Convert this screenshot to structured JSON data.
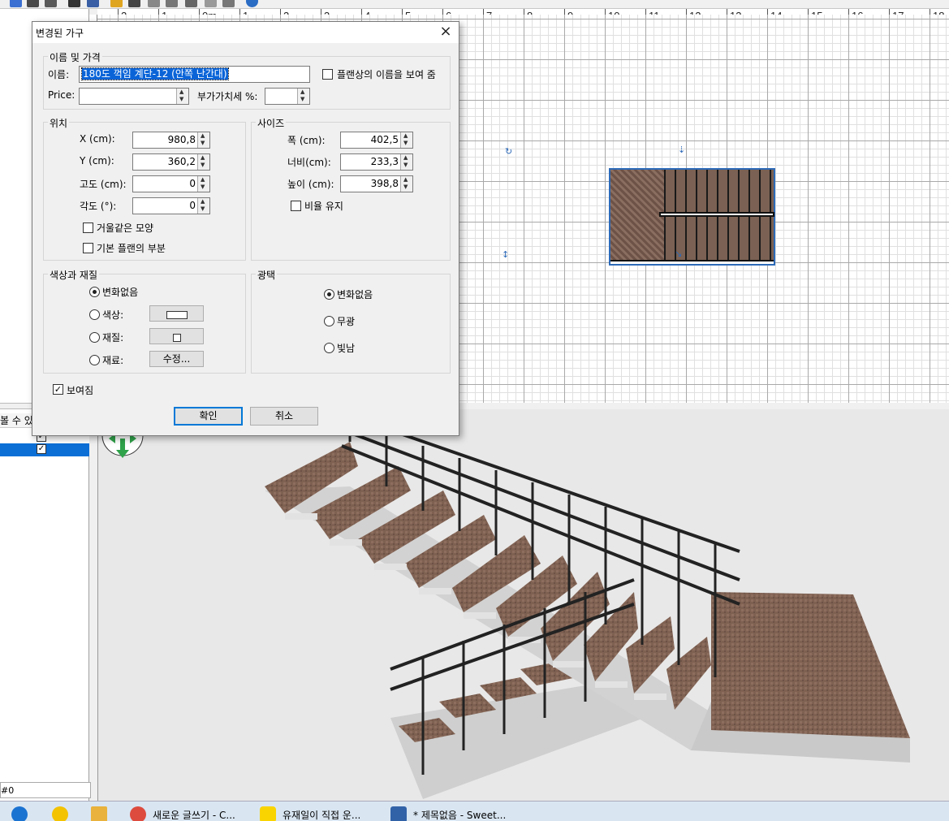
{
  "toolbar": {
    "icons": [
      "zoom-in-icon",
      "zoom-out-icon",
      "camera-icon",
      "image-icon",
      "pencil-icon",
      "wall-icon",
      "room-icon",
      "text-icon",
      "help-icon"
    ]
  },
  "ruler": {
    "labels": [
      "2",
      "1",
      "0m",
      "1",
      "2",
      "3",
      "4",
      "5",
      "6",
      "7",
      "8",
      "9",
      "10",
      "11",
      "12",
      "13",
      "14",
      "15",
      "16",
      "17",
      "18"
    ]
  },
  "left_panel": {
    "header": "볼 수 있",
    "footer": "#0"
  },
  "dialog": {
    "title": "변경된 가구",
    "close": "×",
    "name_price": {
      "legend": "이름 및 가격",
      "name_label": "이름:",
      "name_value": "180도 꺽임 계단-12 (안쪽 난간대)",
      "show_name_label": "플랜상의 이름을 보여 줌",
      "show_name_checked": false,
      "price_label": "Price:",
      "price_value": "",
      "vat_label": "부가가치세 %:",
      "vat_value": ""
    },
    "location": {
      "legend": "위치",
      "x_label": "X (cm):",
      "x_value": "980,8",
      "y_label": "Y (cm):",
      "y_value": "360,2",
      "elev_label": "고도 (cm):",
      "elev_value": "0",
      "angle_label": "각도 (°):",
      "angle_value": "0",
      "mirror_label": "거울같은 모양",
      "mirror_checked": false,
      "base_plan_label": "기본 플랜의 부분",
      "base_plan_checked": false
    },
    "size": {
      "legend": "사이즈",
      "width_label": "폭 (cm):",
      "width_value": "402,5",
      "depth_label": "너비(cm):",
      "depth_value": "233,3",
      "height_label": "높이 (cm):",
      "height_value": "398,8",
      "keep_ratio_label": "비율 유지",
      "keep_ratio_checked": false
    },
    "color": {
      "legend": "색상과 재질",
      "unchanged_label": "변화없음",
      "color_label": "색상:",
      "texture_label": "재질:",
      "materials_label": "재료:",
      "modify_label": "수정...",
      "selected": "unchanged"
    },
    "shininess": {
      "legend": "광택",
      "unchanged_label": "변화없음",
      "matt_label": "무광",
      "shiny_label": "빛남",
      "selected": "unchanged"
    },
    "visible_label": "보여짐",
    "visible_checked": true,
    "ok_label": "확인",
    "cancel_label": "취소"
  },
  "taskbar": {
    "items": [
      {
        "label": "새로운 글쓰기 - C...",
        "icon": "chrome-icon"
      },
      {
        "label": "유재일이 직접 운...",
        "icon": "kakaotalk-icon"
      },
      {
        "label": "* 제목없음 - Sweet...",
        "icon": "sweet-home-3d-icon"
      }
    ],
    "pinned": [
      "edge-icon",
      "media-player-icon",
      "file-explorer-icon"
    ]
  },
  "colors": {
    "selection_blue": "#0a64d8",
    "plan_selection": "#2d6ab8",
    "accent": "#0078d7"
  }
}
